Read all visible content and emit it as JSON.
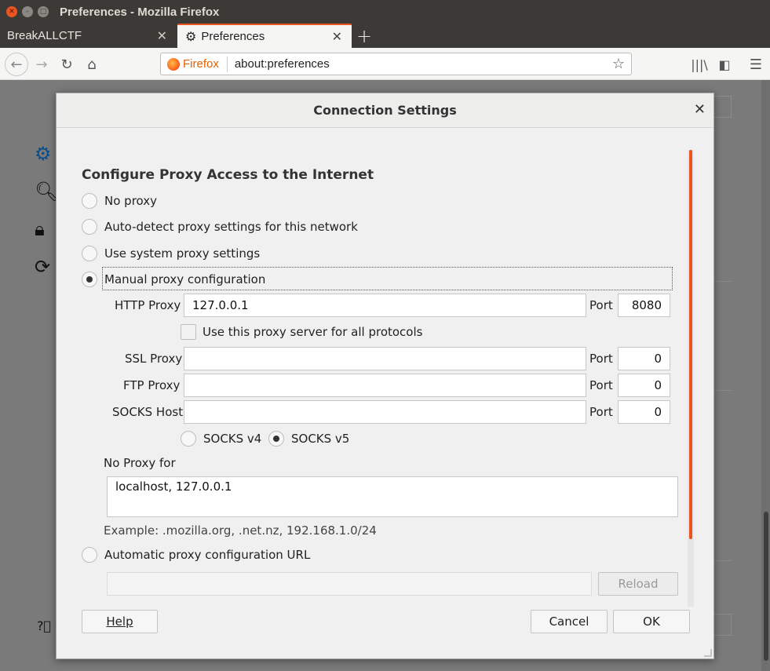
{
  "window": {
    "title": "Preferences - Mozilla Firefox"
  },
  "tabs": [
    {
      "label": "BreakALLCTF"
    },
    {
      "label": "Preferences"
    }
  ],
  "navbar": {
    "identity_label": "Firefox",
    "url": "about:preferences"
  },
  "dialog": {
    "title": "Connection Settings",
    "heading": "Configure Proxy Access to the Internet",
    "options": {
      "no_proxy": "No proxy",
      "auto_detect": "Auto-detect proxy settings for this network",
      "system": "Use system proxy settings",
      "manual": "Manual proxy configuration",
      "auto_url": "Automatic proxy configuration URL"
    },
    "selected_option": "manual",
    "http": {
      "label": "HTTP Proxy",
      "value": "127.0.0.1",
      "port_label": "Port",
      "port": "8080"
    },
    "share_all": {
      "label": "Use this proxy server for all protocols",
      "checked": false
    },
    "ssl": {
      "label": "SSL Proxy",
      "value": "",
      "port_label": "Port",
      "port": "0"
    },
    "ftp": {
      "label": "FTP Proxy",
      "value": "",
      "port_label": "Port",
      "port": "0"
    },
    "socks": {
      "label": "SOCKS Host",
      "value": "",
      "port_label": "Port",
      "port": "0"
    },
    "socks_versions": {
      "v4": "SOCKS v4",
      "v5": "SOCKS v5",
      "selected": "v5"
    },
    "no_proxy_for": {
      "label": "No Proxy for",
      "value": "localhost, 127.0.0.1"
    },
    "example": "Example: .mozilla.org, .net.nz, 192.168.1.0/24",
    "auto_url_value": "",
    "reload_label": "Reload",
    "help_label": "Help",
    "cancel_label": "Cancel",
    "ok_label": "OK"
  },
  "colors": {
    "accent": "#e95420",
    "titlebar": "#3b3a36",
    "firefox_label": "#e66000"
  }
}
